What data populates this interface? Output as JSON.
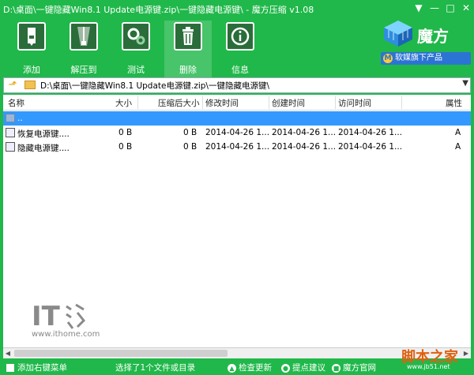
{
  "window": {
    "title": "D:\\桌面\\一键隐藏Win8.1 Update电源键.zip\\一键隐藏电源键\\ - 魔方压缩 v1.08",
    "controls": [
      "▼",
      "—",
      "□",
      "✕"
    ]
  },
  "toolbar": {
    "items": [
      {
        "label": "添加",
        "icon": "add-archive-icon"
      },
      {
        "label": "解压到",
        "icon": "extract-zipper-icon"
      },
      {
        "label": "测试",
        "icon": "test-gears-icon"
      },
      {
        "label": "删除",
        "icon": "delete-trash-icon"
      },
      {
        "label": "信息",
        "icon": "info-icon"
      }
    ],
    "active_index": 3
  },
  "brand": {
    "name": "魔方",
    "badge": "软媒旗下产品",
    "badge_logo": "M"
  },
  "address": {
    "path": "D:\\桌面\\一键隐藏Win8.1 Update电源键.zip\\一键隐藏电源键\\"
  },
  "columns": [
    "名称",
    "大小",
    "压缩后大小",
    "修改时间",
    "创建时间",
    "访问时间",
    "属性"
  ],
  "rows": [
    {
      "name": "..",
      "size": "",
      "packed": "",
      "modified": "",
      "created": "",
      "accessed": "",
      "attr": "",
      "selected": true,
      "kind": "parent"
    },
    {
      "name": "恢复电源键....",
      "size": "0 B",
      "packed": "0 B",
      "modified": "2014-04-26 1...",
      "created": "2014-04-26 1...",
      "accessed": "2014-04-26 1...",
      "attr": "A",
      "selected": false,
      "kind": "file"
    },
    {
      "name": "隐藏电源键....",
      "size": "0 B",
      "packed": "0 B",
      "modified": "2014-04-26 1...",
      "created": "2014-04-26 1...",
      "accessed": "2014-04-26 1...",
      "attr": "A",
      "selected": false,
      "kind": "file"
    }
  ],
  "watermark": {
    "it_text": "IT之家",
    "url": "www.ithome.com"
  },
  "status": {
    "context_menu": "添加右键菜单",
    "selection": "选择了1个文件或目录",
    "check_update": "检查更新",
    "suggest": "提点建议",
    "official": "魔方官网"
  },
  "watermark2": {
    "text": "脚本之家",
    "url": "www.jb51.net"
  },
  "colors": {
    "accent_green": "#20b84a",
    "selection_blue": "#3399ff",
    "badge_blue": "#2c74d3"
  }
}
